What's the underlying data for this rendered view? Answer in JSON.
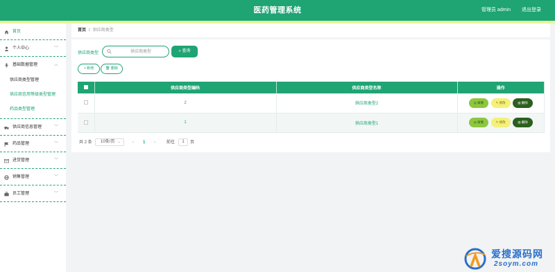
{
  "header": {
    "title": "医药管理系统",
    "user": "管理员 admin",
    "logout": "退出登录"
  },
  "sidebar": {
    "items": [
      {
        "label": "首页",
        "icon": "home-icon",
        "active": true
      },
      {
        "label": "个人中心",
        "icon": "user-icon",
        "expandable": true
      },
      {
        "label": "基础数据管理",
        "icon": "microphone-icon",
        "expandable": true,
        "expanded": true,
        "children": [
          "供应商类型管理",
          "供应商信用等级类型管理",
          "药品类型管理"
        ]
      },
      {
        "label": "供应商信息管理",
        "icon": "truck-icon",
        "expandable": true
      },
      {
        "label": "药品管理",
        "icon": "flag-icon",
        "expandable": true
      },
      {
        "label": "进货管理",
        "icon": "mail-icon",
        "expandable": true
      },
      {
        "label": "销售管理",
        "icon": "globe-icon",
        "expandable": true
      },
      {
        "label": "员工管理",
        "icon": "briefcase-icon",
        "expandable": true
      }
    ]
  },
  "breadcrumb": {
    "home": "首页",
    "separator": "/",
    "current": "供应商类型"
  },
  "search": {
    "label": "供应商类型",
    "placeholder": "供应商类型",
    "value": "",
    "button": "查询"
  },
  "actions": {
    "add": "新增",
    "delete": "删除"
  },
  "table": {
    "columns": [
      "供应商类型编码",
      "供应商类型名称",
      "操作"
    ],
    "rows": [
      {
        "code": "2",
        "name": "供应商类型2"
      },
      {
        "code": "1",
        "name": "供应商类型1"
      }
    ],
    "row_actions": {
      "detail": "详情",
      "edit": "修改",
      "delete": "删除"
    }
  },
  "pagination": {
    "total": "共 2 条",
    "page_size": "10条/页",
    "prev": "‹",
    "current_page": "1",
    "next": "›",
    "goto": "前往",
    "goto_value": "1",
    "unit": "页"
  },
  "watermark": {
    "cn": "爱搜源码网",
    "en": "2soym.com"
  },
  "colors": {
    "primary": "#1fa474",
    "accent_strip": "#e8f59a",
    "detail": "#8dc63f",
    "edit": "#f4f07a",
    "delete": "#2b5f1e"
  }
}
